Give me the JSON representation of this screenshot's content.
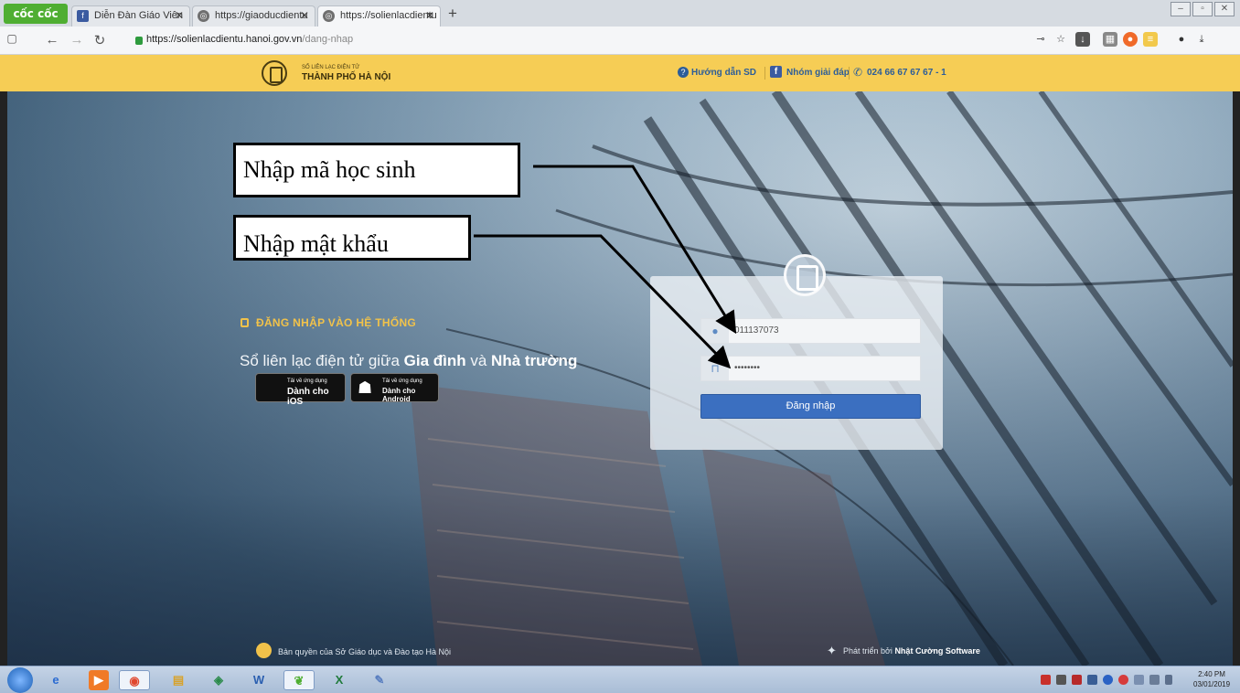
{
  "browser": {
    "brand": "cốc cốc",
    "tabs": [
      {
        "label": "Diễn Đàn Giáo Viên"
      },
      {
        "label": "https://giaoducdientu"
      },
      {
        "label": "https://solienlacdientu"
      }
    ],
    "new_tab": "+",
    "url_host": "https://solienlacdientu.hanoi.gov.vn",
    "url_path": "/dang-nhap"
  },
  "site_header": {
    "subtitle": "SỔ LIÊN LẠC ĐIỆN TỬ",
    "title": "THÀNH PHỐ HÀ NỘI",
    "help_link": "Hướng dẫn SD",
    "group_link": "Nhóm giải đáp",
    "phone": "024 66 67 67 67 - 1"
  },
  "annotations": {
    "student_id_note": "Nhập mã học sinh",
    "password_note": "Nhập mật khẩu"
  },
  "hero": {
    "login_heading": "ĐĂNG NHẬP VÀO HỆ THỐNG",
    "tagline_prefix": "Sổ liên lạc điện tử giữa ",
    "tagline_family": "Gia đình",
    "tagline_and": " và ",
    "tagline_school": "Nhà trường",
    "ios_line1": "Tải về ứng dụng",
    "ios_line2": "Dành cho iOS",
    "android_line1": "Tải về ứng dụng",
    "android_line2": "Dành cho Android"
  },
  "login_form": {
    "username_value": "011137073",
    "password_value": "••••••••",
    "submit_label": "Đăng nhập"
  },
  "footer": {
    "copyright": "Bản quyền của Sở Giáo dục và Đào tạo Hà Nội",
    "developed_by": "Phát triển bởi ",
    "developer": "Nhật Cường Software"
  },
  "taskbar": {
    "time": "2:40 PM",
    "date": "03/01/2019"
  },
  "colors": {
    "header_yellow": "#f6cd55",
    "login_button": "#3b6fc0",
    "heading_gold": "#f1c24a"
  }
}
